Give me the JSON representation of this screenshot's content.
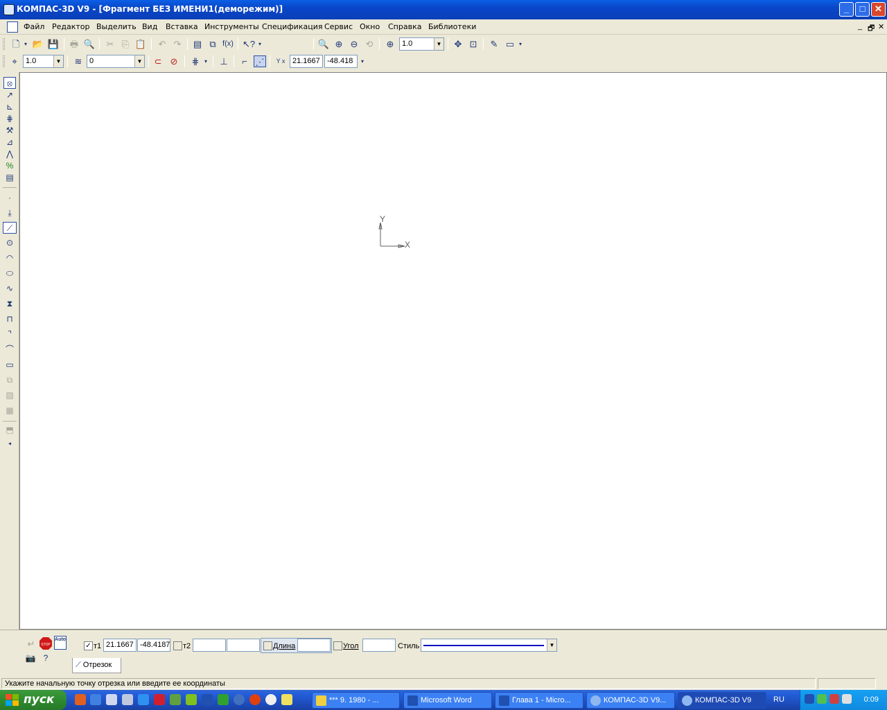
{
  "window": {
    "title": "КОМПАС-3D V9 - [Фрагмент БЕЗ ИМЕНИ1(деморежим)]",
    "controls": [
      "_",
      "□",
      "✕"
    ]
  },
  "menu": {
    "items": [
      "Файл",
      "Редактор",
      "Выделить",
      "Вид",
      "Вставка",
      "Инструменты",
      "Спецификация",
      "Сервис",
      "Окно",
      "Справка",
      "Библиотеки"
    ],
    "mdi_controls": [
      "_",
      "🗗",
      "✕"
    ]
  },
  "toolbar1": {
    "zoom_value": "1.0"
  },
  "toolbar2": {
    "step_value": "1.0",
    "layer_value": "0",
    "coord_x": "21.1667",
    "coord_y": "-48.418",
    "coord_label": "Y x"
  },
  "canvas": {
    "axis_y": "Y",
    "axis_x": "X"
  },
  "propbar": {
    "t1_label": "т1",
    "t1_checked": "✓",
    "t1_x": "21.1667",
    "t1_y": "-48.4187",
    "t2_label": "т2",
    "t2_x": "",
    "t2_y": "",
    "length_label": "Длина",
    "length_value": "",
    "angle_label": "Угол",
    "angle_value": "",
    "style_label": "Стиль",
    "tab_label": "Отрезок",
    "auto_label": "Auto",
    "stop_label": "STOP"
  },
  "status": {
    "hint": "Укажите начальную точку отрезка или введите ее координаты"
  },
  "taskbar": {
    "start_label": "пуск",
    "tasks": [
      "*** 9. 1980 - ...",
      "Microsoft Word",
      "Глава 1 - Micro...",
      "КОМПАС-3D V9...",
      "КОМПАС-3D V9"
    ],
    "language": "RU",
    "clock": "0:09"
  },
  "colors": {
    "title_bar": "#0a5fe6",
    "taskbar": "#245edb",
    "start_button": "#2f8a2f",
    "style_line": "#0000c0"
  }
}
